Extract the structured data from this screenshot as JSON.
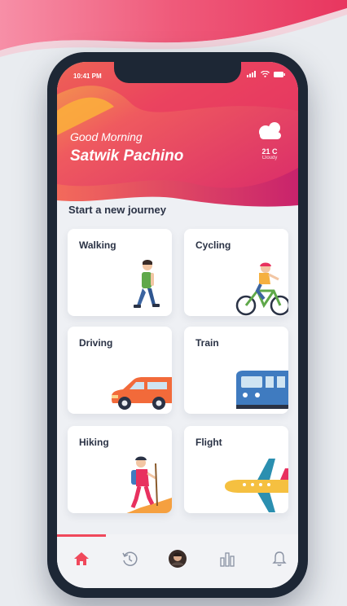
{
  "status": {
    "time": "10:41 PM"
  },
  "greeting": {
    "line1": "Good Morning",
    "name": "Satwik Pachino"
  },
  "weather": {
    "temp": "21 C",
    "condition": "Cloudy",
    "icon": "cloud-icon"
  },
  "section_title": "Start a new journey",
  "modes": [
    {
      "label": "Walking",
      "icon": "walking-person-icon"
    },
    {
      "label": "Cycling",
      "icon": "cyclist-icon"
    },
    {
      "label": "Driving",
      "icon": "car-icon"
    },
    {
      "label": "Train",
      "icon": "train-icon"
    },
    {
      "label": "Hiking",
      "icon": "hiker-icon"
    },
    {
      "label": "Flight",
      "icon": "airplane-icon"
    }
  ],
  "tabs": [
    {
      "name": "home-icon",
      "active": true
    },
    {
      "name": "history-icon",
      "active": false
    },
    {
      "name": "avatar",
      "active": false
    },
    {
      "name": "stats-icon",
      "active": false
    },
    {
      "name": "bell-icon",
      "active": false
    }
  ],
  "colors": {
    "accent": "#f0485b",
    "dark": "#2a3245",
    "orange": "#fbb03b",
    "pink": "#e8315f"
  }
}
